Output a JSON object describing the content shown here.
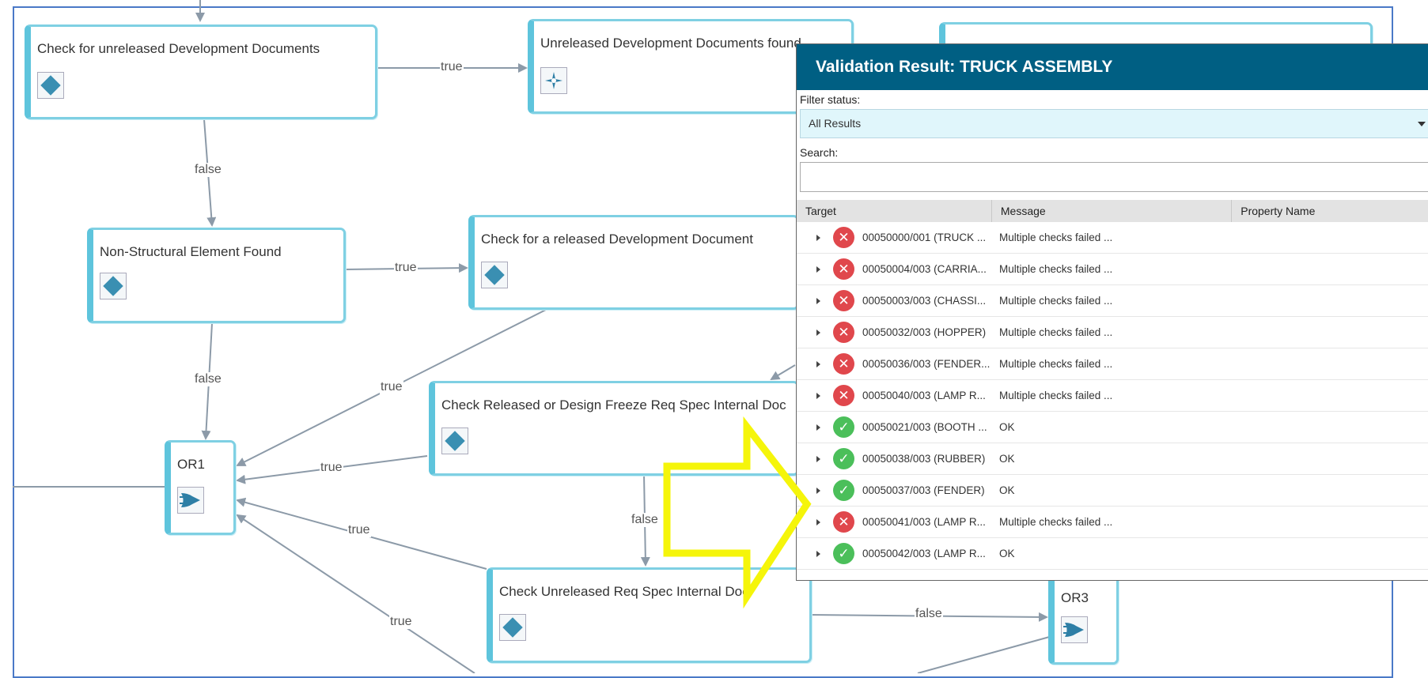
{
  "diagram": {
    "nodes": {
      "check_unreleased_dev": "Check for unreleased Development Documents",
      "unreleased_dev_found": "Unreleased Development Documents found",
      "non_structural": "Non-Structural Element Found",
      "check_released_dev": "Check for a released Development Document",
      "check_released_freeze": "Check Released or Design Freeze Req Spec Internal Doc",
      "or1": "OR1",
      "check_unreleased_req": "Check Unreleased Req Spec Internal Doc",
      "or3": "OR3"
    },
    "edge_labels": {
      "true_label": "true",
      "false_label": "false"
    },
    "icons": {
      "decision": "diamond-icon",
      "action": "star-icon",
      "or_gate": "or-gate-icon",
      "pointer": "yellow-arrow-icon"
    },
    "colors": {
      "node_border": "#5ec4dc",
      "edge": "#8c9aa8",
      "highlight_arrow": "#f5f50a"
    }
  },
  "panel": {
    "title": "Validation Result: TRUCK ASSEMBLY",
    "filter_label": "Filter status:",
    "filter_value": "All Results",
    "search_label": "Search:",
    "search_value": "",
    "columns": [
      "Target",
      "Message",
      "Property Name"
    ],
    "rows": [
      {
        "status": "error",
        "target": "00050000/001 (TRUCK ...",
        "message": "Multiple checks failed ..."
      },
      {
        "status": "error",
        "target": "00050004/003 (CARRIA...",
        "message": "Multiple checks failed ..."
      },
      {
        "status": "error",
        "target": "00050003/003 (CHASSI...",
        "message": "Multiple checks failed ..."
      },
      {
        "status": "error",
        "target": "00050032/003 (HOPPER)",
        "message": "Multiple checks failed ..."
      },
      {
        "status": "error",
        "target": "00050036/003 (FENDER...",
        "message": "Multiple checks failed ..."
      },
      {
        "status": "error",
        "target": "00050040/003 (LAMP R...",
        "message": "Multiple checks failed ..."
      },
      {
        "status": "ok",
        "target": "00050021/003 (BOOTH ...",
        "message": "OK"
      },
      {
        "status": "ok",
        "target": "00050038/003 (RUBBER)",
        "message": "OK"
      },
      {
        "status": "ok",
        "target": "00050037/003 (FENDER)",
        "message": "OK"
      },
      {
        "status": "error",
        "target": "00050041/003 (LAMP R...",
        "message": "Multiple checks failed ..."
      },
      {
        "status": "ok",
        "target": "00050042/003 (LAMP R...",
        "message": "OK"
      }
    ],
    "colors": {
      "title_bg": "#005f83",
      "error": "#e0474c",
      "ok": "#4bbf5a"
    }
  }
}
